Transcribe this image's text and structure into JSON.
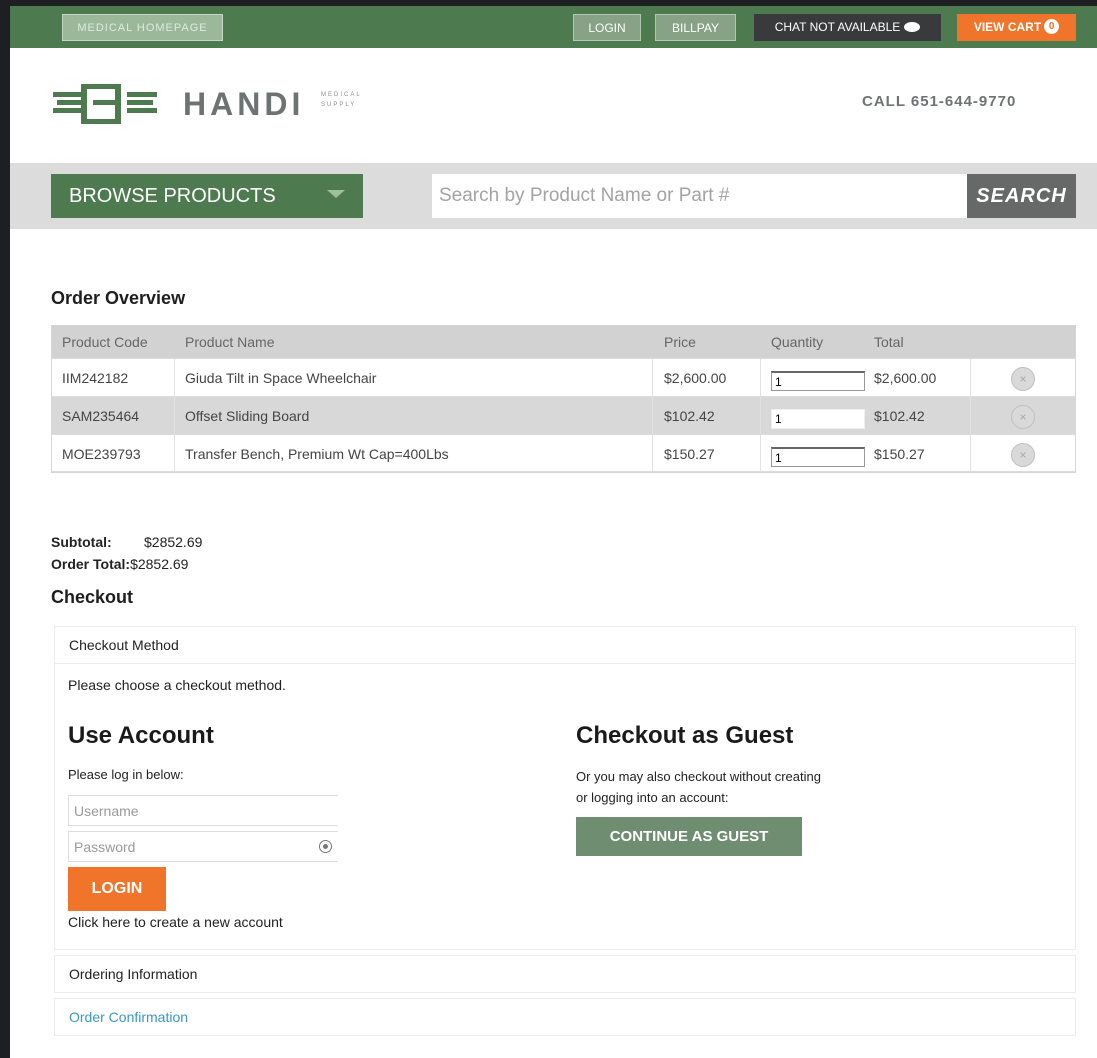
{
  "topbar": {
    "left_label": "MEDICAL HOMEPAGE",
    "login": "LOGIN",
    "billpay": "BILLPAY",
    "chat": "CHAT NOT AVAILABLE",
    "cart": "VIEW CART",
    "cart_count": "0"
  },
  "header": {
    "brand": "HANDI",
    "brand_sub": "MEDICAL SUPPLY",
    "phone": "CALL 651-644-9770"
  },
  "nav": {
    "browse": "BROWSE PRODUCTS",
    "search_placeholder": "Search by Product Name or Part #",
    "search_button": "SEARCH"
  },
  "order": {
    "title": "Order Overview",
    "columns": [
      "Product Code",
      "Product Name",
      "Price",
      "Quantity",
      "Total"
    ],
    "rows": [
      {
        "code": "IIM242182",
        "name": "Giuda Tilt in Space Wheelchair",
        "price": "$2,600.00",
        "qty": "1",
        "total": "$2,600.00"
      },
      {
        "code": "SAM235464",
        "name": "Offset Sliding Board",
        "price": "$102.42",
        "qty": "1",
        "total": "$102.42"
      },
      {
        "code": "MOE239793",
        "name": "Transfer Bench, Premium Wt Cap=400Lbs",
        "price": "$150.27",
        "qty": "1",
        "total": "$150.27"
      }
    ]
  },
  "totals": {
    "subtotal_label": "Subtotal:",
    "subtotal": "$2852.69",
    "order_total_label": "Order Total:",
    "order_total": "$2852.69"
  },
  "checkout": {
    "title": "Checkout",
    "method_title": "Checkout Method",
    "choose": "Please choose a checkout method.",
    "use_account": "Use Account",
    "login_note": "Please log in below:",
    "username_placeholder": "Username",
    "password_placeholder": "Password",
    "login_button": "LOGIN",
    "create_account": "Click here to create a new account",
    "guest_title": "Checkout as Guest",
    "guest_note": "Or you may also checkout without creating or logging into an account:",
    "guest_button": "CONTINUE AS GUEST",
    "ordering_info": "Ordering Information",
    "order_confirmation": "Order Confirmation"
  },
  "colors": {
    "brand_green": "#4d7a4f",
    "accent_orange": "#f0742a",
    "link_blue": "#3a97c4"
  }
}
